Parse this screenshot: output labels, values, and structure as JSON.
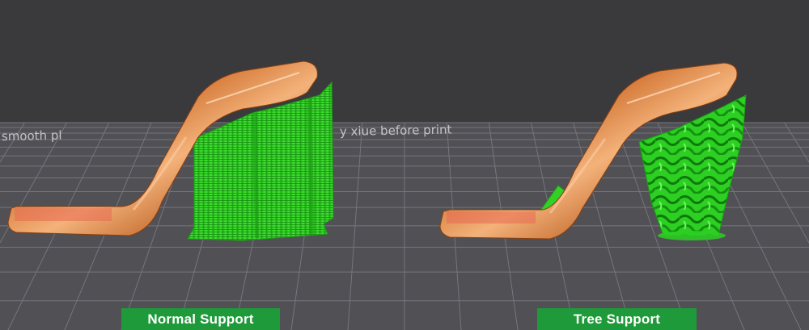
{
  "labels": {
    "normal": "Normal Support",
    "tree": "Tree Support"
  },
  "bed_text": {
    "left": "smooth pl",
    "right": "y xiue before print"
  },
  "colors": {
    "background": "#3a3a3d",
    "bed": "#505055",
    "grid": "#75757c",
    "model": "#d9772d",
    "support": "#38d62a",
    "badge": "#1f9a3a"
  }
}
